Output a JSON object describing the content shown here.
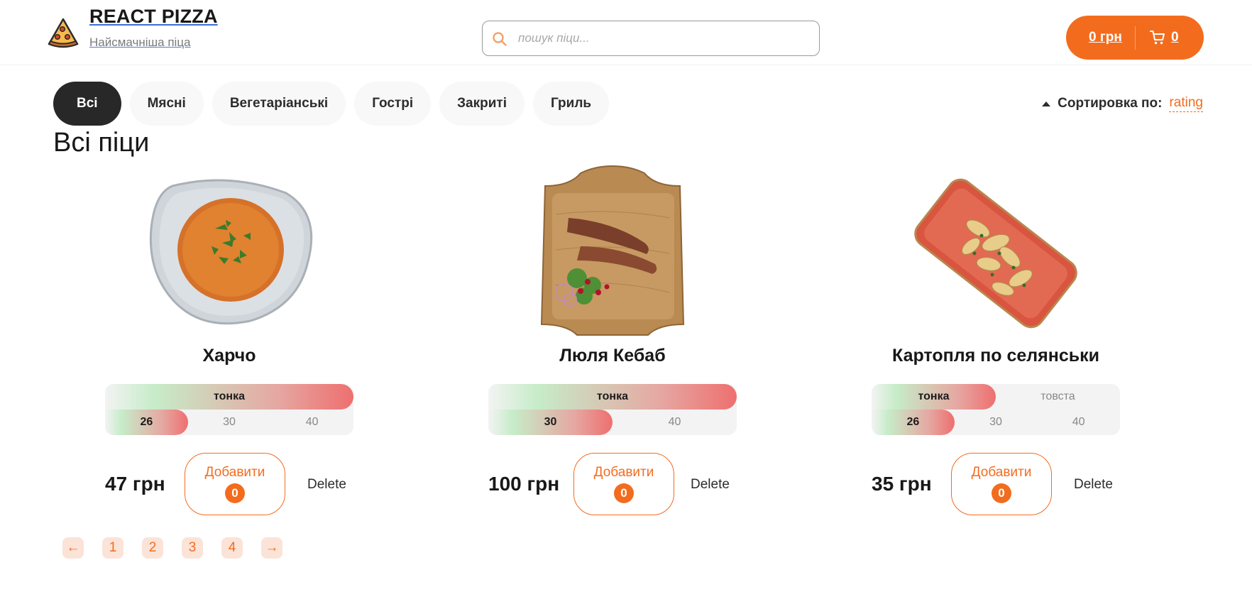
{
  "header": {
    "title": "REACT PIZZA",
    "subtitle": "Найсмачніша піца",
    "search_placeholder": "пошук піци...",
    "cart_price": "0 грн",
    "cart_count": "0"
  },
  "categories": [
    "Всі",
    "Мясні",
    "Вегетаріанські",
    "Гострі",
    "Закриті",
    "Гриль"
  ],
  "active_category": "Всі",
  "sort": {
    "label": "Сортировка по:",
    "value": "rating"
  },
  "page_title": "Всі піци",
  "items": [
    {
      "name": "Харчо",
      "types": [
        "тонка"
      ],
      "selected_type": "тонка",
      "sizes": [
        "26",
        "30",
        "40"
      ],
      "selected_size": "26",
      "price": "47 грн",
      "add_label": "Добавити",
      "add_count": "0",
      "delete_label": "Delete"
    },
    {
      "name": "Люля Кебаб",
      "types": [
        "тонка"
      ],
      "selected_type": "тонка",
      "sizes": [
        "30",
        "40"
      ],
      "selected_size": "30",
      "price": "100 грн",
      "add_label": "Добавити",
      "add_count": "0",
      "delete_label": "Delete"
    },
    {
      "name": "Картопля по селянськи",
      "types": [
        "тонка",
        "товста"
      ],
      "selected_type": "тонка",
      "sizes": [
        "26",
        "30",
        "40"
      ],
      "selected_size": "26",
      "price": "35 грн",
      "add_label": "Добавити",
      "add_count": "0",
      "delete_label": "Delete"
    }
  ],
  "pagination": [
    "←",
    "1",
    "2",
    "3",
    "4",
    "→"
  ],
  "colors": {
    "accent": "#f36c1e",
    "dark": "#282828"
  }
}
